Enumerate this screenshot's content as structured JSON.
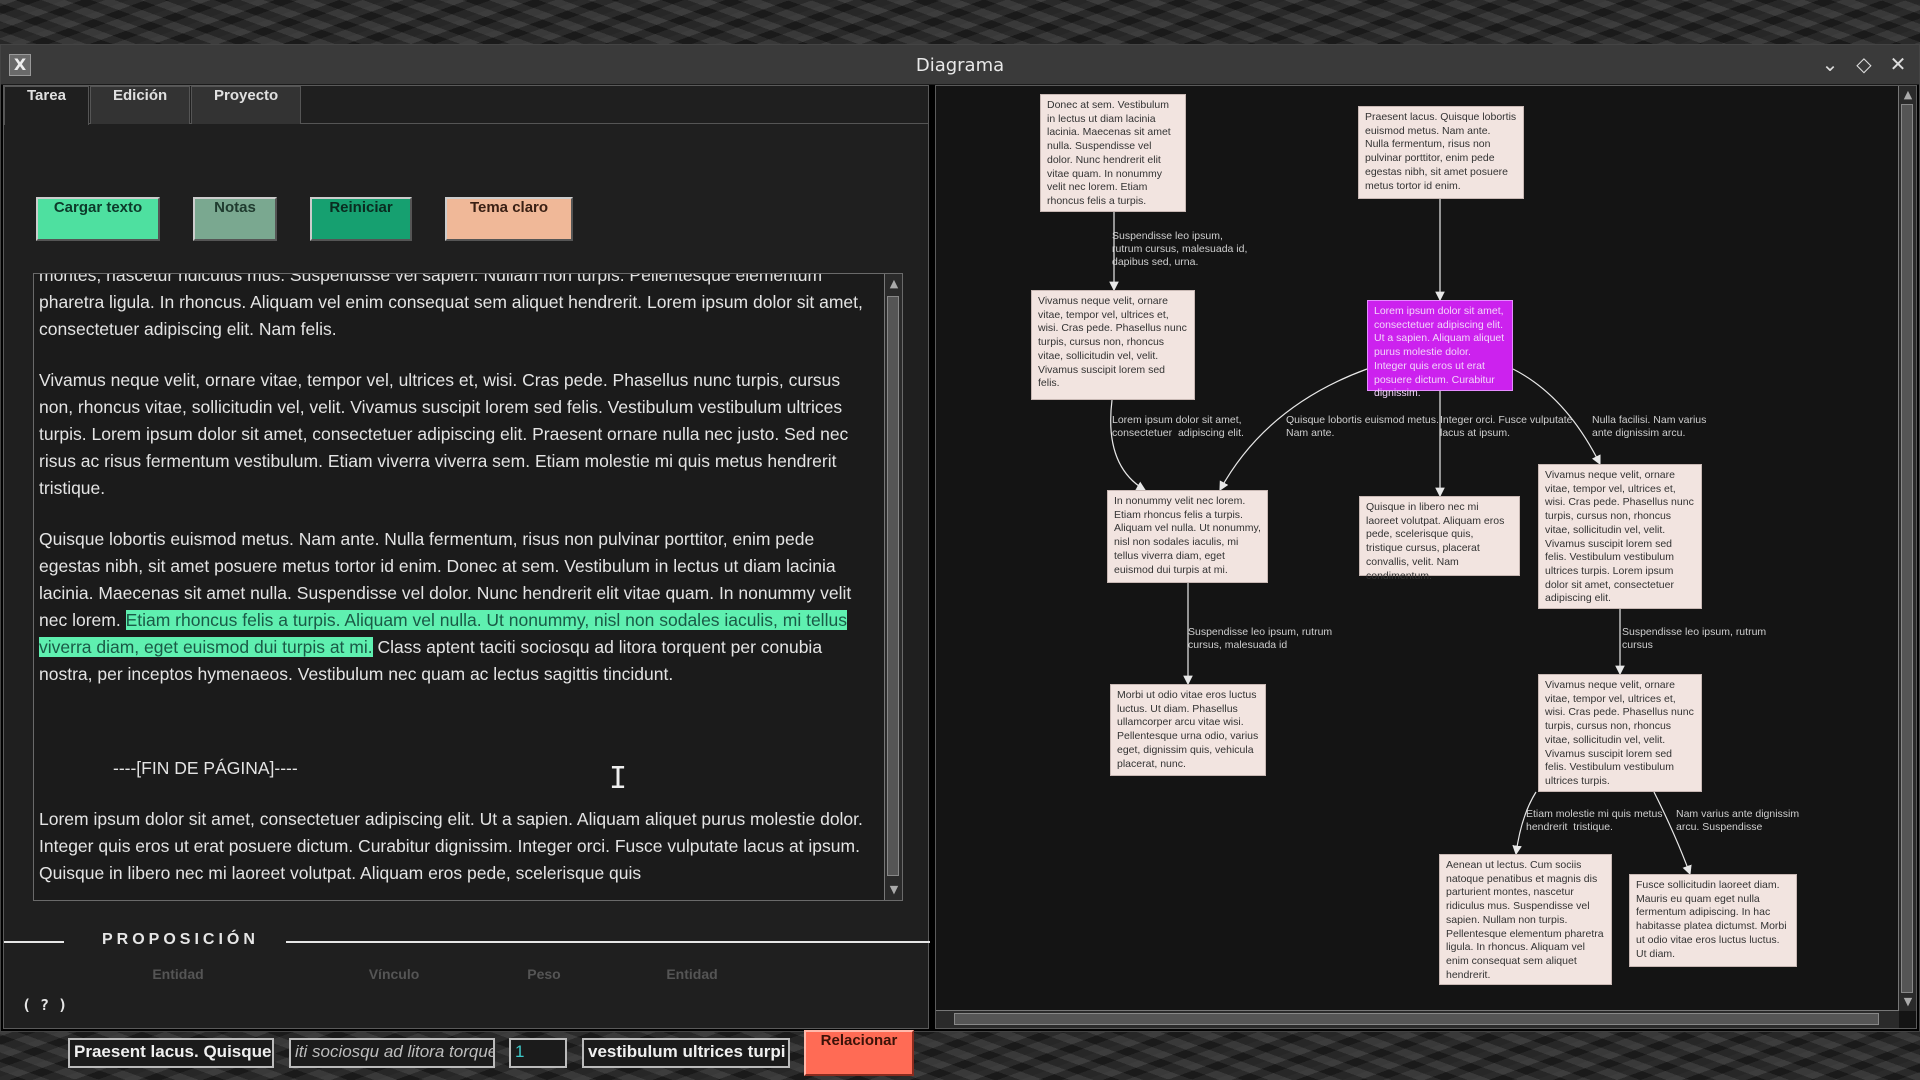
{
  "window": {
    "title": "Diagrama",
    "app_icon": "X",
    "controls": {
      "minimize": "⌄",
      "maximize": "◇",
      "close": "✕"
    }
  },
  "tabs": [
    "Tarea",
    "Edición",
    "Proyecto"
  ],
  "toolbar": {
    "load_text": "Cargar texto",
    "notes": "Notas",
    "reset": "Reiniciar",
    "theme": "Tema claro"
  },
  "editor": {
    "partial_top": "montes, nascetur ridiculus mus.  Suspendisse vel sapien. Nullam non turpis. Pellentesque elementum pharetra ligula. In  rhoncus. Aliquam vel enim consequat sem aliquet hendrerit. Lorem ipsum dolor sit amet, consectetuer adipiscing elit. Nam felis.",
    "p2": "Vivamus neque velit, ornare vitae, tempor vel, ultrices et, wisi. Cras pede. Phasellus  nunc turpis, cursus non, rhoncus vitae, sollicitudin vel, velit. Vivamus suscipit lorem sed  felis. Vestibulum vestibulum ultrices turpis. Lorem ipsum dolor sit amet, consectetuer  adipiscing elit. Praesent ornare nulla nec justo. Sed nec risus ac risus fermentum  vestibulum. Etiam viverra viverra sem. Etiam molestie mi quis metus hendrerit  tristique.",
    "p3_before": "Quisque lobortis euismod metus. Nam ante. Nulla fermentum, risus non pulvinar  porttitor, enim pede egestas nibh, sit amet posuere metus tortor id enim. Donec at  sem. Vestibulum in lectus ut diam lacinia lacinia. Maecenas sit amet nulla. Suspendisse  vel dolor. Nunc hendrerit elit vitae quam. In nonummy velit nec lorem. ",
    "p3_highlight": "Etiam rhoncus  felis a turpis. Aliquam vel nulla. Ut nonummy, nisl non sodales iaculis, mi tellus viverra  diam, eget euismod dui turpis at mi.",
    "p3_after": " Class aptent taciti sociosqu ad litora torquent per  conubia nostra, per inceptos hymenaeos. Vestibulum nec quam ac lectus sagittis tincidunt.",
    "page_break": "----[FIN DE PÁGINA]----",
    "p4": "Lorem ipsum dolor sit amet, consectetuer adipiscing elit. Ut a sapien. Aliquam aliquet  purus molestie dolor. Integer quis eros ut erat posuere dictum. Curabitur dignissim.  Integer orci. Fusce vulputate lacus at ipsum. Quisque in libero nec mi laoreet volutpat.  Aliquam eros pede, scelerisque quis"
  },
  "proposition": {
    "title": "PROPOSICIÓN",
    "help": "( ? )",
    "labels": {
      "entity1": "Entidad",
      "link": "Vínculo",
      "weight": "Peso",
      "entity2": "Entidad"
    },
    "entity1_value": "Praesent lacus. Quisque",
    "link_value": "iti sociosqu ad litora torque",
    "weight_value": "1",
    "entity2_value": "vestibulum ultrices turpi",
    "relate_button": "Relacionar"
  },
  "diagram": {
    "nodes": [
      {
        "id": "n1",
        "text": "Donec at  sem. Vestibulum in lectus ut diam lacinia lacinia. Maecenas sit amet nulla. Suspendisse  vel dolor. Nunc hendrerit elit vitae quam. In nonummy velit nec lorem. Etiam rhoncus  felis a turpis."
      },
      {
        "id": "n2",
        "text": "Praesent lacus. Quisque lobortis euismod metus. Nam ante. Nulla fermentum, risus non pulvinar porttitor, enim pede egestas nibh, sit amet posuere metus tortor id enim."
      },
      {
        "id": "n3",
        "text": "Vivamus neque velit, ornare vitae, tempor vel, ultrices et, wisi. Cras pede. Phasellus nunc turpis, cursus non, rhoncus vitae, sollicitudin vel, velit. Vivamus suscipit lorem sed felis."
      },
      {
        "id": "n4",
        "text": "Lorem ipsum dolor sit amet, consectetuer adipiscing elit. Ut a sapien. Aliquam aliquet purus molestie dolor. Integer quis eros ut erat posuere dictum. Curabitur dignissim.",
        "selected": true
      },
      {
        "id": "n5",
        "text": "In nonummy velit nec lorem. Etiam rhoncus  felis a turpis. Aliquam vel nulla. Ut nonummy, nisl non sodales iaculis, mi tellus viverra  diam, eget euismod dui turpis at mi."
      },
      {
        "id": "n6",
        "text": "Quisque in libero nec mi laoreet volutpat.  Aliquam eros pede, scelerisque quis, tristique cursus, placerat convallis, velit. Nam  condimentum."
      },
      {
        "id": "n7",
        "text": "Vivamus neque velit, ornare vitae, tempor vel, ultrices et, wisi. Cras pede. Phasellus nunc turpis, cursus non, rhoncus vitae, sollicitudin vel, velit. Vivamus suscipit lorem sed felis. Vestibulum vestibulum ultrices turpis. Lorem ipsum dolor sit amet, consectetuer adipiscing elit."
      },
      {
        "id": "n8",
        "text": "Morbi ut odio vitae eros luctus luctus. Ut diam. Phasellus ullamcorper arcu vitae wisi. Pellentesque urna odio, varius eget, dignissim quis,  vehicula placerat, nunc."
      },
      {
        "id": "n9",
        "text": "Vivamus neque velit, ornare vitae, tempor vel, ultrices et, wisi. Cras pede. Phasellus nunc turpis, cursus non, rhoncus vitae, sollicitudin vel, velit. Vivamus suscipit lorem sed felis. Vestibulum vestibulum ultrices turpis."
      },
      {
        "id": "n10",
        "text": "Aenean ut lectus.  Cum sociis natoque penatibus et magnis dis parturient montes, nascetur ridiculus mus.  Suspendisse vel sapien. Nullam non turpis. Pellentesque elementum pharetra ligula. In  rhoncus. Aliquam vel enim consequat sem aliquet hendrerit."
      },
      {
        "id": "n11",
        "text": "Fusce  sollicitudin laoreet diam. Mauris eu quam eget nulla fermentum adipiscing. In hac  habitasse platea dictumst. Morbi ut odio vitae eros luctus luctus. Ut diam."
      }
    ],
    "edge_labels": [
      {
        "id": "e1",
        "text": "Suspendisse leo ipsum,\nrutrum cursus, malesuada id,\ndapibus sed, urna."
      },
      {
        "id": "e2",
        "text": "Lorem ipsum dolor sit amet,\nconsectetuer  adipiscing elit."
      },
      {
        "id": "e3",
        "text": "Quisque lobortis euismod metus.\nNam ante."
      },
      {
        "id": "e4",
        "text": "Integer orci. Fusce vulputate\nlacus at ipsum."
      },
      {
        "id": "e5",
        "text": "Nulla facilisi. Nam varius\nante dignissim arcu."
      },
      {
        "id": "e6",
        "text": "Suspendisse leo ipsum, rutrum\ncursus, malesuada id"
      },
      {
        "id": "e7",
        "text": "Suspendisse leo ipsum, rutrum\ncursus"
      },
      {
        "id": "e8",
        "text": "Etiam molestie mi quis metus\nhendrerit  tristique."
      },
      {
        "id": "e9",
        "text": "Nam varius ante dignissim\narcu. Suspendisse"
      }
    ]
  },
  "colors": {
    "load_text_btn": "#4ee0a0",
    "notes_btn": "#7aa890",
    "reset_btn": "#16a070",
    "theme_btn": "#f0b898",
    "relate_btn": "#ff6b55",
    "highlight": "#5ff0b0",
    "node_bg": "#f2e4e0",
    "selected_node": "#cc22ee"
  }
}
